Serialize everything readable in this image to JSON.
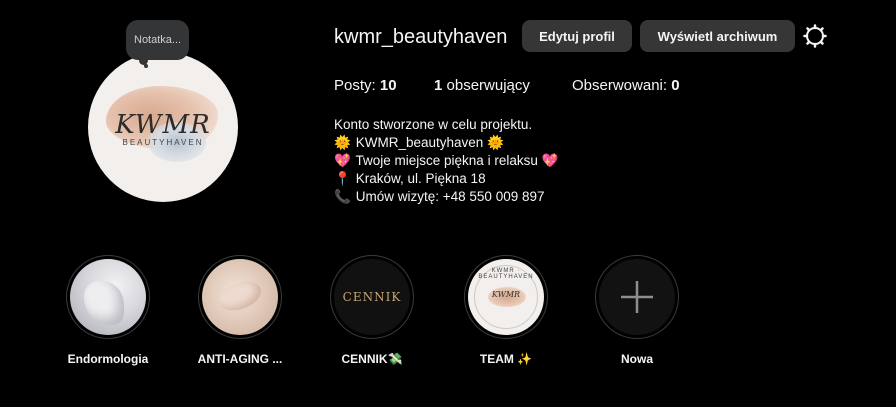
{
  "profile": {
    "note_label": "Notatka...",
    "username": "kwmr_beautyhaven",
    "avatar_logo": "KWMR",
    "avatar_sub": "BEAUTYHAVEN"
  },
  "buttons": {
    "edit_profile": "Edytuj profil",
    "view_archive": "Wyświetl archiwum"
  },
  "icons": {
    "settings": "gear-icon"
  },
  "stats": {
    "posts_label": "Posty: ",
    "posts_value": "10",
    "followers_value": "1",
    "followers_label": " obserwujący",
    "following_label": "Obserwowani: ",
    "following_value": "0"
  },
  "bio": {
    "line1": "Konto stworzone w celu projektu.",
    "line2_emoji": "🌞",
    "line2": " KWMR_beautyhaven ",
    "line2_emoji_end": "🌞",
    "line3_emoji": "💖",
    "line3": " Twoje miejsce piękna i relaksu ",
    "line3_emoji_end": "💖",
    "line4_emoji": "📍",
    "line4": " Kraków, ul. Piękna 18",
    "line5_emoji": "📞",
    "line5": " Umów wizytę: +48 550 009 897"
  },
  "highlights": [
    {
      "label": "Endormologia"
    },
    {
      "label": "ANTI-AGING ..."
    },
    {
      "label": "CENNIK💸",
      "cover_text": "CENNIK"
    },
    {
      "label": "TEAM ✨",
      "cover_text": "KWMR",
      "cover_ring_text": "KWMR · BEAUTYHAVEN"
    },
    {
      "label": "Nowa"
    }
  ]
}
